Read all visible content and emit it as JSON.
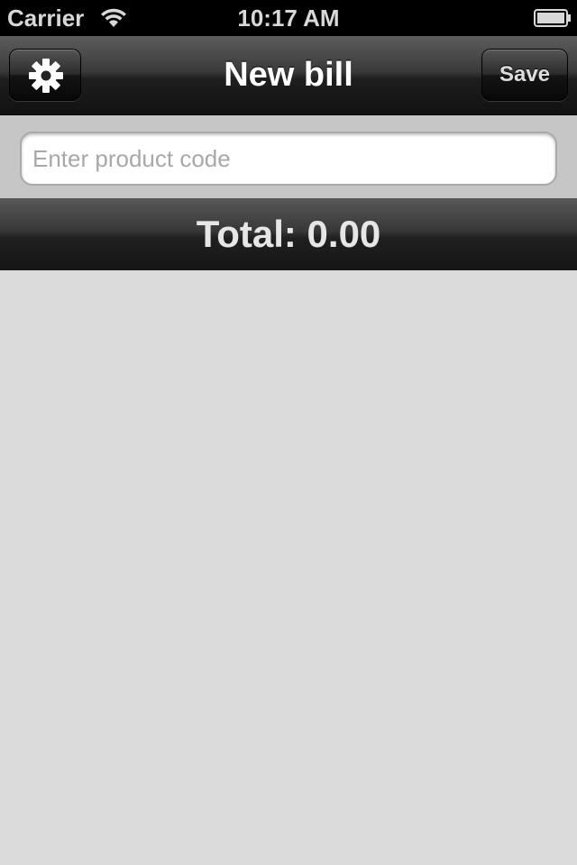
{
  "status_bar": {
    "carrier": "Carrier",
    "time": "10:17 AM",
    "wifi_icon": "wifi-icon",
    "battery_icon": "battery-icon"
  },
  "nav_bar": {
    "title": "New bill",
    "settings_icon": "gear-icon",
    "save_label": "Save"
  },
  "product_input": {
    "value": "",
    "placeholder": "Enter product code"
  },
  "total": {
    "text": "Total: 0.00"
  },
  "colors": {
    "nav_bar": "#2a2a2a",
    "background": "#dbdbdb",
    "input_area": "#c6c6c6",
    "total_text": "#e6e6e6"
  }
}
